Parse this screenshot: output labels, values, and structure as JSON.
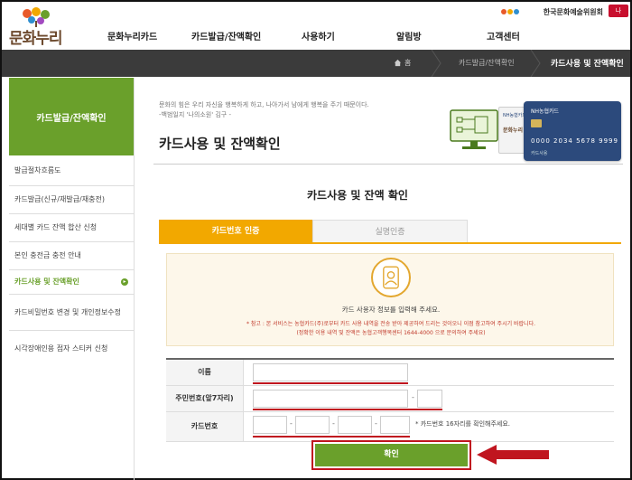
{
  "header": {
    "logo_text": "문화누리",
    "org_name": "한국문화예술위원회",
    "lang_label": "나",
    "nav": [
      "문화누리카드",
      "카드발급/잔액확인",
      "사용하기",
      "알림방",
      "고객센터"
    ]
  },
  "breadcrumb": {
    "home": "홈",
    "parent": "카드발급/잔액확인",
    "current": "카드사용 및 잔액확인"
  },
  "sidebar": {
    "title": "카드발급/잔액확인",
    "items": [
      {
        "label": "발급절차흐름도"
      },
      {
        "label": "카드발급(신규/재발급/재충전)"
      },
      {
        "label": "세대별 카드 잔액 합산 신청"
      },
      {
        "label": "본인 충전금 충전 안내"
      },
      {
        "label": "카드사용 및 잔액확인"
      },
      {
        "label": "카드비밀번호 변경 및 개인정보수정"
      },
      {
        "label": "시각장애인용 점자 스티커 신청"
      }
    ]
  },
  "intro": {
    "quote_line1": "문화의 힘은 우리 자신을 행복하게 하고, 나아가서 남에게 행복을 주기 때문이다.",
    "quote_line2": "-백범일지 '나의소원' 김구 -",
    "title": "카드사용 및 잔액확인"
  },
  "illustration": {
    "card_bank": "NH농협카드",
    "card_number": "0000 2034 5678 9999",
    "card_foot": "카드사용",
    "card1_bank": "NH농협카드",
    "card1_brand": "문화누리"
  },
  "section": {
    "title": "카드사용 및 잔액 확인"
  },
  "tabs": [
    {
      "label": "카드번호 인증"
    },
    {
      "label": "실명인증"
    }
  ],
  "info": {
    "main": "카드 사용자 정보를 입력해 주세요.",
    "note1": "* 참고 : 본 서비스는 농협카드(주)로부터 카드 사용 내역을 전송 받아 제공하여 드리는 것이오니 이점 참고하여 주시기 바랍니다.",
    "note2": "(정확한 이용 내역 및 잔액은 농협고객행복센터 1644-4000 으로 문의하여 주세요)"
  },
  "form": {
    "name_label": "이름",
    "id_label": "주민번호(앞7자리)",
    "card_label": "카드번호",
    "card_hint": "* 카드번호 16자리를 확인해주세요.",
    "name_value": "",
    "id_front_value": "",
    "id_back_value": "",
    "card_parts": [
      "",
      "",
      "",
      ""
    ]
  },
  "confirm": {
    "label": "확인"
  },
  "colors": {
    "green": "#6aa02b",
    "orange": "#f2a800",
    "dark": "#3b3b3b",
    "highlight_red": "#c0151f"
  }
}
